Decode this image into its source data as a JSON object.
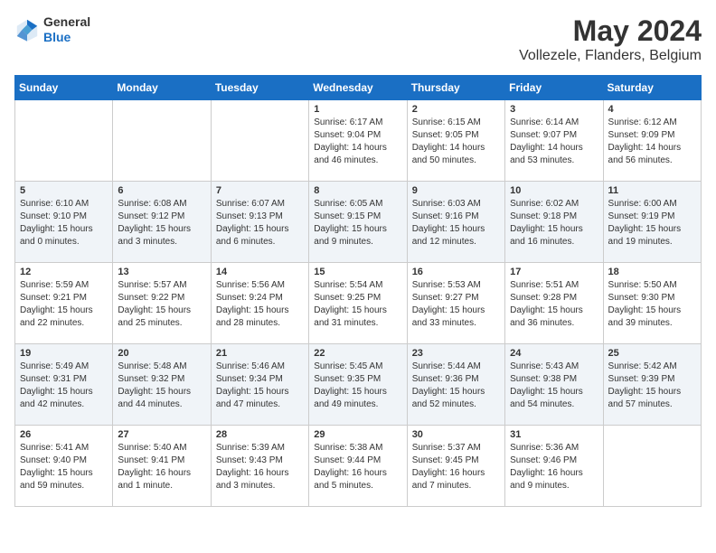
{
  "header": {
    "logo": {
      "general": "General",
      "blue": "Blue"
    },
    "title": "May 2024",
    "location": "Vollezele, Flanders, Belgium"
  },
  "days_of_week": [
    "Sunday",
    "Monday",
    "Tuesday",
    "Wednesday",
    "Thursday",
    "Friday",
    "Saturday"
  ],
  "weeks": [
    [
      {
        "day": "",
        "info": ""
      },
      {
        "day": "",
        "info": ""
      },
      {
        "day": "",
        "info": ""
      },
      {
        "day": "1",
        "info": "Sunrise: 6:17 AM\nSunset: 9:04 PM\nDaylight: 14 hours\nand 46 minutes."
      },
      {
        "day": "2",
        "info": "Sunrise: 6:15 AM\nSunset: 9:05 PM\nDaylight: 14 hours\nand 50 minutes."
      },
      {
        "day": "3",
        "info": "Sunrise: 6:14 AM\nSunset: 9:07 PM\nDaylight: 14 hours\nand 53 minutes."
      },
      {
        "day": "4",
        "info": "Sunrise: 6:12 AM\nSunset: 9:09 PM\nDaylight: 14 hours\nand 56 minutes."
      }
    ],
    [
      {
        "day": "5",
        "info": "Sunrise: 6:10 AM\nSunset: 9:10 PM\nDaylight: 15 hours\nand 0 minutes."
      },
      {
        "day": "6",
        "info": "Sunrise: 6:08 AM\nSunset: 9:12 PM\nDaylight: 15 hours\nand 3 minutes."
      },
      {
        "day": "7",
        "info": "Sunrise: 6:07 AM\nSunset: 9:13 PM\nDaylight: 15 hours\nand 6 minutes."
      },
      {
        "day": "8",
        "info": "Sunrise: 6:05 AM\nSunset: 9:15 PM\nDaylight: 15 hours\nand 9 minutes."
      },
      {
        "day": "9",
        "info": "Sunrise: 6:03 AM\nSunset: 9:16 PM\nDaylight: 15 hours\nand 12 minutes."
      },
      {
        "day": "10",
        "info": "Sunrise: 6:02 AM\nSunset: 9:18 PM\nDaylight: 15 hours\nand 16 minutes."
      },
      {
        "day": "11",
        "info": "Sunrise: 6:00 AM\nSunset: 9:19 PM\nDaylight: 15 hours\nand 19 minutes."
      }
    ],
    [
      {
        "day": "12",
        "info": "Sunrise: 5:59 AM\nSunset: 9:21 PM\nDaylight: 15 hours\nand 22 minutes."
      },
      {
        "day": "13",
        "info": "Sunrise: 5:57 AM\nSunset: 9:22 PM\nDaylight: 15 hours\nand 25 minutes."
      },
      {
        "day": "14",
        "info": "Sunrise: 5:56 AM\nSunset: 9:24 PM\nDaylight: 15 hours\nand 28 minutes."
      },
      {
        "day": "15",
        "info": "Sunrise: 5:54 AM\nSunset: 9:25 PM\nDaylight: 15 hours\nand 31 minutes."
      },
      {
        "day": "16",
        "info": "Sunrise: 5:53 AM\nSunset: 9:27 PM\nDaylight: 15 hours\nand 33 minutes."
      },
      {
        "day": "17",
        "info": "Sunrise: 5:51 AM\nSunset: 9:28 PM\nDaylight: 15 hours\nand 36 minutes."
      },
      {
        "day": "18",
        "info": "Sunrise: 5:50 AM\nSunset: 9:30 PM\nDaylight: 15 hours\nand 39 minutes."
      }
    ],
    [
      {
        "day": "19",
        "info": "Sunrise: 5:49 AM\nSunset: 9:31 PM\nDaylight: 15 hours\nand 42 minutes."
      },
      {
        "day": "20",
        "info": "Sunrise: 5:48 AM\nSunset: 9:32 PM\nDaylight: 15 hours\nand 44 minutes."
      },
      {
        "day": "21",
        "info": "Sunrise: 5:46 AM\nSunset: 9:34 PM\nDaylight: 15 hours\nand 47 minutes."
      },
      {
        "day": "22",
        "info": "Sunrise: 5:45 AM\nSunset: 9:35 PM\nDaylight: 15 hours\nand 49 minutes."
      },
      {
        "day": "23",
        "info": "Sunrise: 5:44 AM\nSunset: 9:36 PM\nDaylight: 15 hours\nand 52 minutes."
      },
      {
        "day": "24",
        "info": "Sunrise: 5:43 AM\nSunset: 9:38 PM\nDaylight: 15 hours\nand 54 minutes."
      },
      {
        "day": "25",
        "info": "Sunrise: 5:42 AM\nSunset: 9:39 PM\nDaylight: 15 hours\nand 57 minutes."
      }
    ],
    [
      {
        "day": "26",
        "info": "Sunrise: 5:41 AM\nSunset: 9:40 PM\nDaylight: 15 hours\nand 59 minutes."
      },
      {
        "day": "27",
        "info": "Sunrise: 5:40 AM\nSunset: 9:41 PM\nDaylight: 16 hours\nand 1 minute."
      },
      {
        "day": "28",
        "info": "Sunrise: 5:39 AM\nSunset: 9:43 PM\nDaylight: 16 hours\nand 3 minutes."
      },
      {
        "day": "29",
        "info": "Sunrise: 5:38 AM\nSunset: 9:44 PM\nDaylight: 16 hours\nand 5 minutes."
      },
      {
        "day": "30",
        "info": "Sunrise: 5:37 AM\nSunset: 9:45 PM\nDaylight: 16 hours\nand 7 minutes."
      },
      {
        "day": "31",
        "info": "Sunrise: 5:36 AM\nSunset: 9:46 PM\nDaylight: 16 hours\nand 9 minutes."
      },
      {
        "day": "",
        "info": ""
      }
    ]
  ]
}
